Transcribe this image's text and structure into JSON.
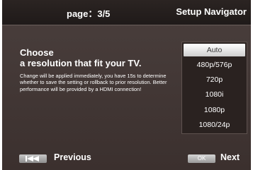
{
  "header": {
    "page_indicator": "page：3/5",
    "title": "Setup Navigator"
  },
  "main": {
    "heading_line1": "Choose",
    "heading_line2": "a resolution that fit your TV.",
    "description": "Change will be applied immediately, you have 15s to determine whether to save the setting or rollback to prior resolution. Better performance will be provided by a HDMI connection!"
  },
  "resolutions": {
    "selected": "Auto",
    "options": [
      "Auto",
      "480p/576p",
      "720p",
      "1080i",
      "1080p",
      "1080/24p"
    ]
  },
  "footer": {
    "previous_label": "Previous",
    "ok_label": "OK",
    "next_label": "Next",
    "previous_icon": "skip-back-icon"
  },
  "colors": {
    "background": "#3b302e",
    "header_background": "#1f1a19",
    "selected_item": "#ffffff"
  }
}
